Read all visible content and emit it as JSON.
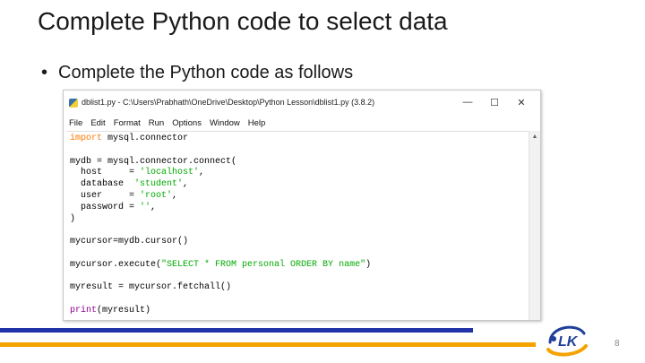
{
  "slide": {
    "title": "Complete Python code to select data",
    "bullet": "Complete the Python code as follows",
    "bullet_symbol": "•",
    "page_number": "8",
    "logo_text": "LK"
  },
  "window": {
    "title": "dblist1.py - C:\\Users\\Prabhath\\OneDrive\\Desktop\\Python Lesson\\dblist1.py (3.8.2)",
    "controls": {
      "minimize": "—",
      "maximize": "☐",
      "close": "✕"
    },
    "menu": [
      "File",
      "Edit",
      "Format",
      "Run",
      "Options",
      "Window",
      "Help"
    ]
  },
  "code_lines": [
    [
      {
        "t": "import",
        "c": "kw"
      },
      {
        "t": " mysql.connector"
      }
    ],
    [
      {
        "t": ""
      }
    ],
    [
      {
        "t": "mydb = mysql.connector.connect("
      }
    ],
    [
      {
        "t": "  host     = "
      },
      {
        "t": "'localhost'",
        "c": "str"
      },
      {
        "t": ","
      }
    ],
    [
      {
        "t": "  database  "
      },
      {
        "t": "'student'",
        "c": "str"
      },
      {
        "t": ","
      }
    ],
    [
      {
        "t": "  user     = "
      },
      {
        "t": "'root'",
        "c": "str"
      },
      {
        "t": ","
      }
    ],
    [
      {
        "t": "  password = "
      },
      {
        "t": "''",
        "c": "str"
      },
      {
        "t": ","
      }
    ],
    [
      {
        "t": ")"
      }
    ],
    [
      {
        "t": ""
      }
    ],
    [
      {
        "t": "mycursor=mydb.cursor()"
      }
    ],
    [
      {
        "t": ""
      }
    ],
    [
      {
        "t": "mycursor.execute("
      },
      {
        "t": "\"SELECT * FROM personal ORDER BY name\"",
        "c": "str"
      },
      {
        "t": ")"
      }
    ],
    [
      {
        "t": ""
      }
    ],
    [
      {
        "t": "myresult = mycursor.fetchall()"
      }
    ],
    [
      {
        "t": ""
      }
    ],
    [
      {
        "t": "print",
        "c": "bi"
      },
      {
        "t": "(myresult)"
      }
    ]
  ],
  "colors": {
    "keyword": "#ff7700",
    "builtin": "#900090",
    "string": "#00aa00",
    "bar_blue": "#2233aa",
    "bar_orange": "#f4a300",
    "logo_blue": "#1f3f9a",
    "logo_orange": "#f4a300"
  }
}
